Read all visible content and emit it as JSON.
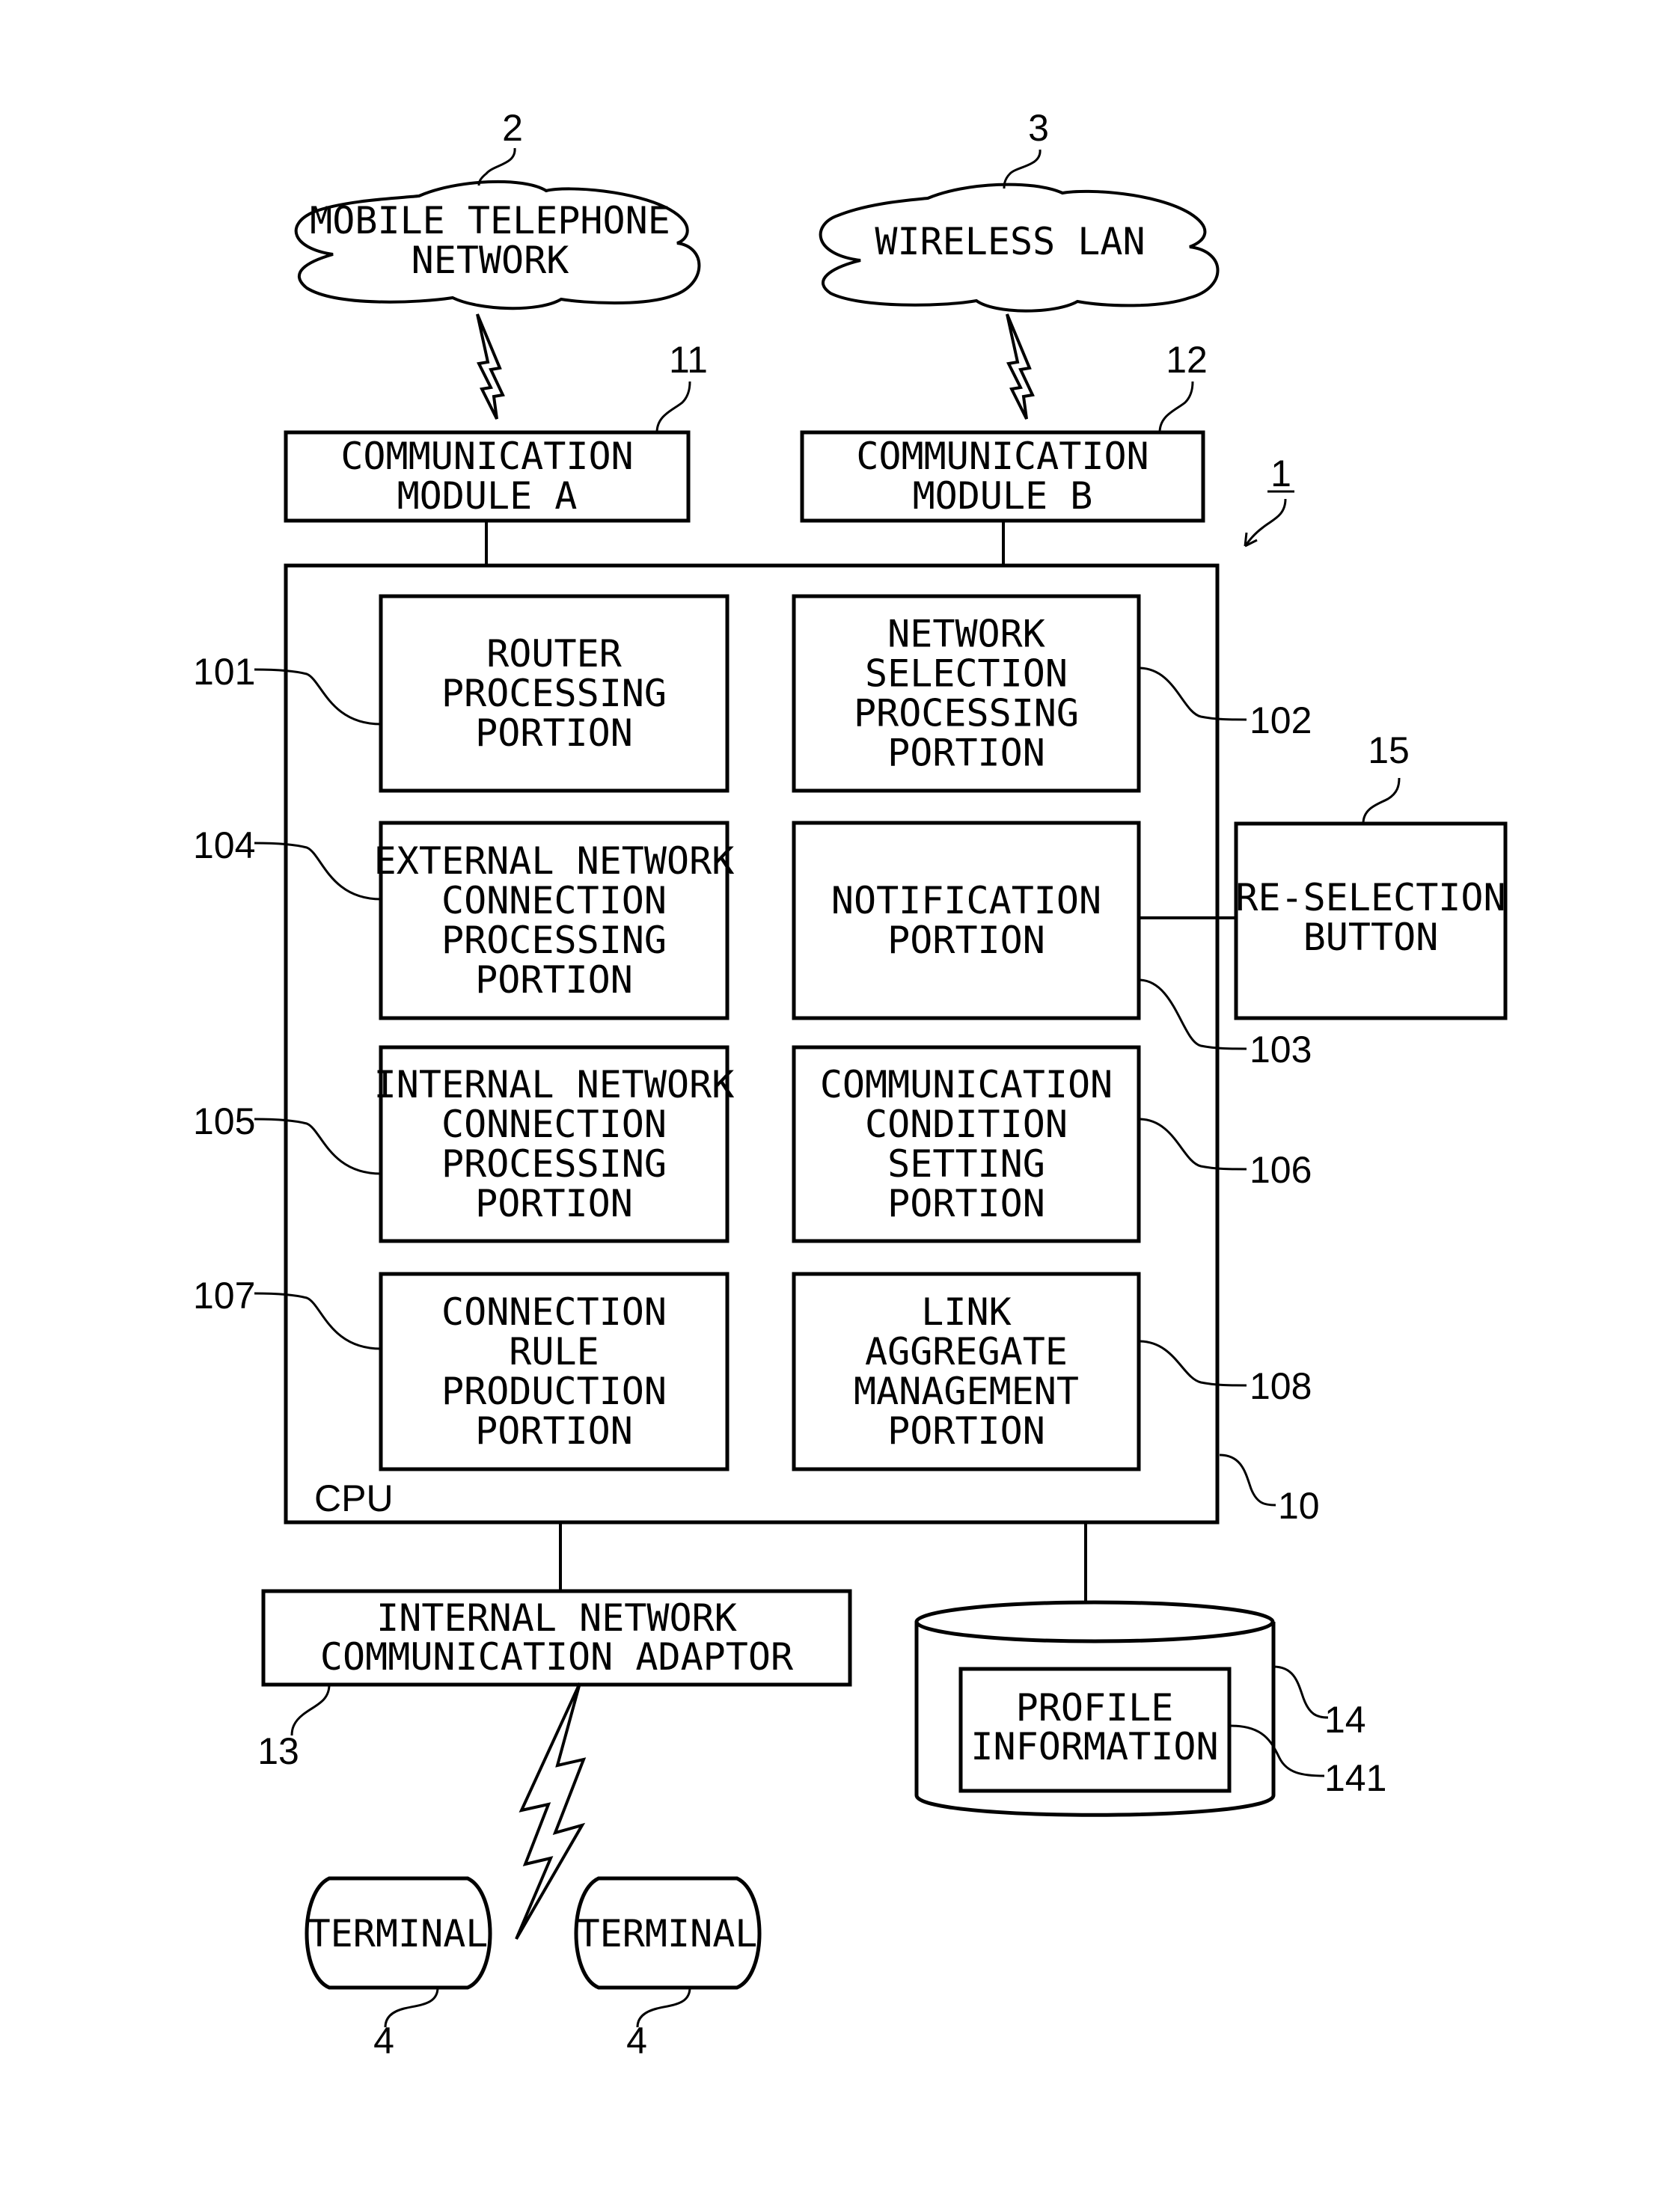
{
  "figure": {
    "system_ref": "1",
    "networks": [
      {
        "ref": "2",
        "lines": [
          "MOBILE TELEPHONE",
          "NETWORK"
        ]
      },
      {
        "ref": "3",
        "lines": [
          "WIRELESS LAN"
        ]
      }
    ],
    "modules": [
      {
        "ref": "11",
        "lines": [
          "COMMUNICATION",
          "MODULE A"
        ]
      },
      {
        "ref": "12",
        "lines": [
          "COMMUNICATION",
          "MODULE B"
        ]
      }
    ],
    "cpu": {
      "ref": "10",
      "label": "CPU",
      "portions": [
        {
          "ref": "101",
          "lines": [
            "ROUTER",
            "PROCESSING",
            "PORTION"
          ]
        },
        {
          "ref": "102",
          "lines": [
            "NETWORK",
            "SELECTION",
            "PROCESSING",
            "PORTION"
          ]
        },
        {
          "ref": "104",
          "lines": [
            "EXTERNAL NETWORK",
            "CONNECTION",
            "PROCESSING",
            "PORTION"
          ]
        },
        {
          "ref": "103",
          "lines": [
            "NOTIFICATION",
            "PORTION"
          ]
        },
        {
          "ref": "105",
          "lines": [
            "INTERNAL NETWORK",
            "CONNECTION",
            "PROCESSING",
            "PORTION"
          ]
        },
        {
          "ref": "106",
          "lines": [
            "COMMUNICATION",
            "CONDITION",
            "SETTING",
            "PORTION"
          ]
        },
        {
          "ref": "107",
          "lines": [
            "CONNECTION",
            "RULE",
            "PRODUCTION",
            "PORTION"
          ]
        },
        {
          "ref": "108",
          "lines": [
            "LINK",
            "AGGREGATE",
            "MANAGEMENT",
            "PORTION"
          ]
        }
      ]
    },
    "reselection_button": {
      "ref": "15",
      "lines": [
        "RE-SELECTION",
        "BUTTON"
      ]
    },
    "adaptor": {
      "ref": "13",
      "lines": [
        "INTERNAL NETWORK",
        "COMMUNICATION ADAPTOR"
      ]
    },
    "storage": {
      "ref": "14",
      "profile": {
        "ref": "141",
        "lines": [
          "PROFILE",
          "INFORMATION"
        ]
      }
    },
    "terminals": [
      {
        "ref": "4",
        "label": "TERMINAL"
      },
      {
        "ref": "4",
        "label": "TERMINAL"
      }
    ]
  }
}
